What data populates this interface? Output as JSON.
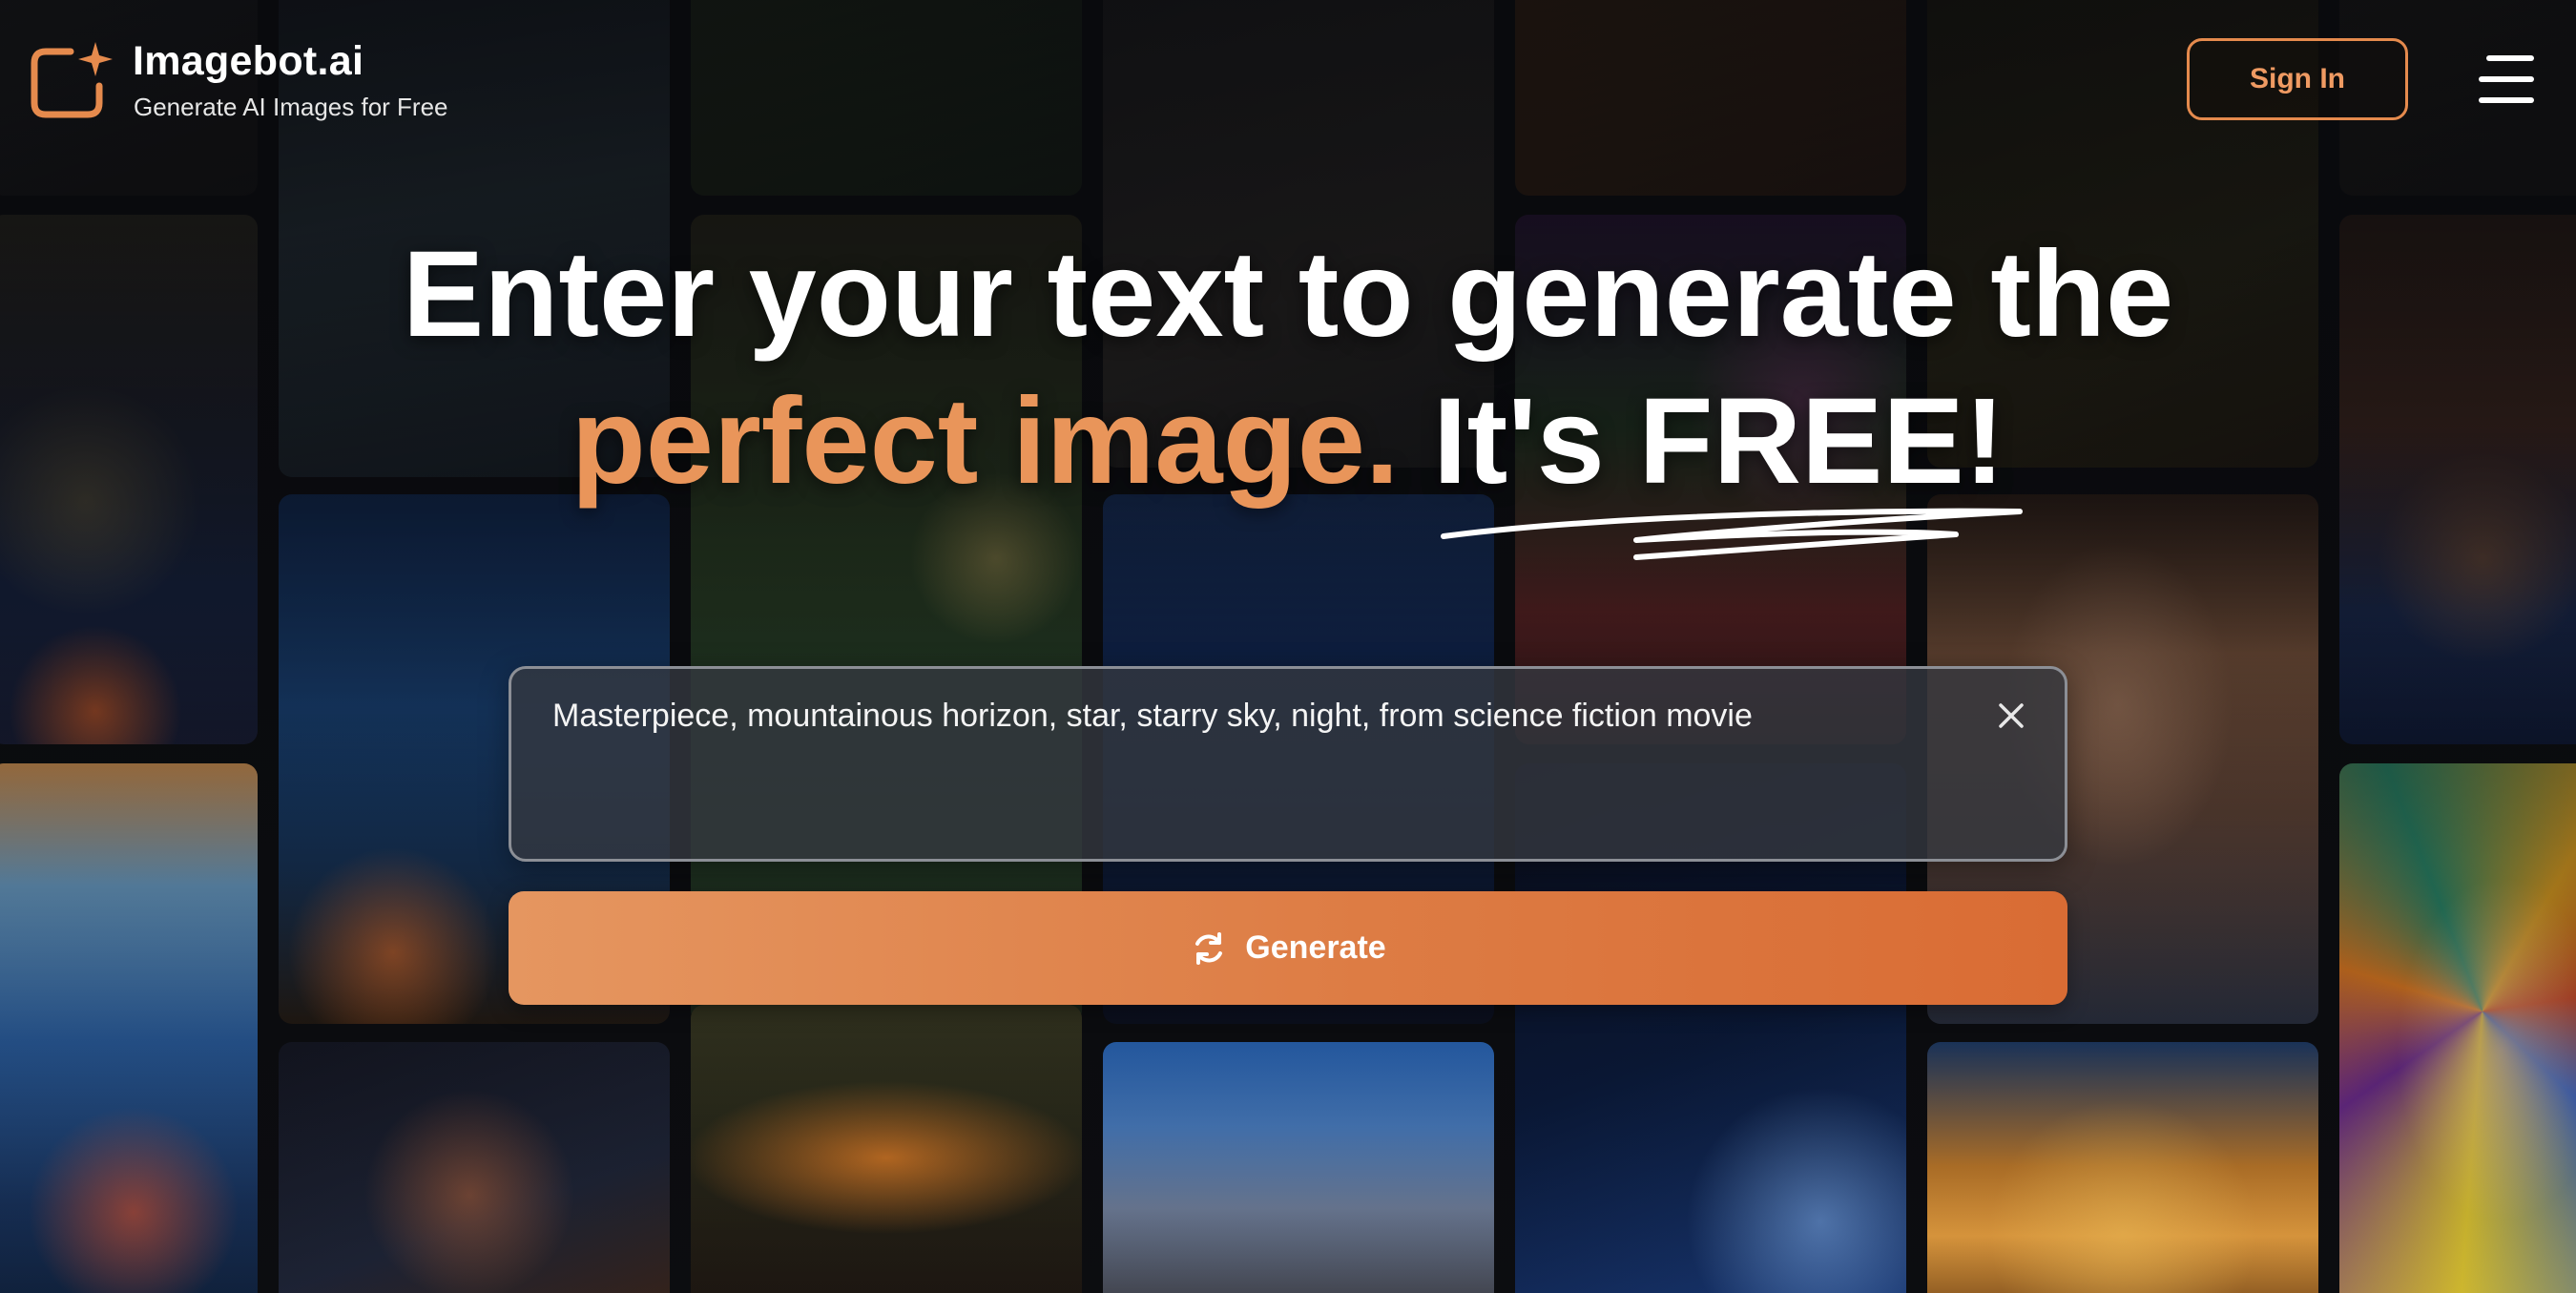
{
  "header": {
    "brand_name": "Imagebot.ai",
    "brand_tagline": "Generate AI Images for Free",
    "sign_in_label": "Sign In",
    "menu_icon": "hamburger-menu-icon",
    "logo_icon": "image-sparkle-logo-icon"
  },
  "hero": {
    "headline_line1": "Enter your text to generate the",
    "headline_highlight": "perfect image.",
    "headline_rest": "It's FREE!"
  },
  "prompt": {
    "value": "Masterpiece, mountainous horizon, star, starry sky, night, from science fiction movie",
    "clear_icon": "close-icon"
  },
  "generate": {
    "label": "Generate",
    "icon": "refresh-icon"
  },
  "colors": {
    "accent": "#e58a4d",
    "accent_text": "#e9955a",
    "background": "#0c0d10",
    "button_start": "#e59660",
    "button_end": "#d96c34"
  }
}
